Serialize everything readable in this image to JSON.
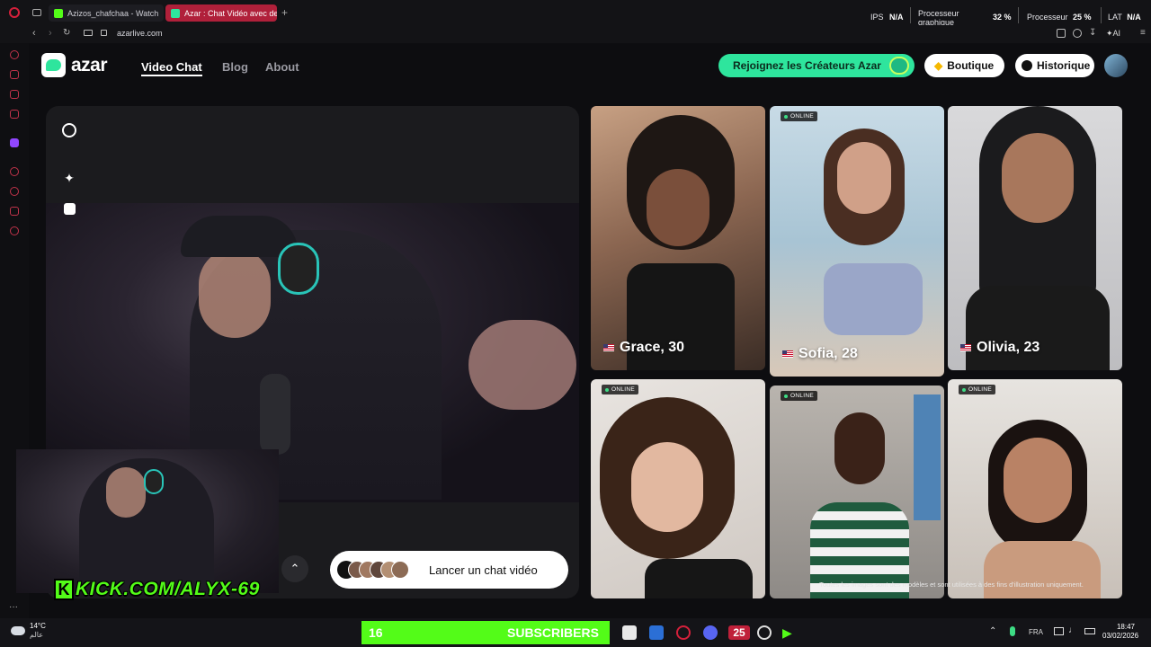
{
  "browser": {
    "tabs": [
      {
        "label": "Azizos_chafchaa - Watch",
        "active": false
      },
      {
        "label": "Azar : Chat Vidéo avec de",
        "active": true
      }
    ],
    "new_tab_symbol": "+",
    "url": "azarlive.com",
    "hud": {
      "ips_label": "IPS",
      "ips_value": "N/A",
      "gpu_label": "Processeur graphique",
      "gpu_value": "32 %",
      "cpu_label": "Processeur",
      "cpu_value": "25 %",
      "lat_label": "LAT",
      "lat_value": "N/A"
    },
    "ai_label": "AI"
  },
  "header": {
    "logo_text": "azar",
    "nav": [
      {
        "label": "Video Chat",
        "active": true
      },
      {
        "label": "Blog",
        "active": false
      },
      {
        "label": "About",
        "active": false
      }
    ],
    "creators_button": "Rejoignez les Créateurs Azar",
    "shop_button": "Boutique",
    "history_button": "Historique"
  },
  "video": {
    "start_button": "Lancer un chat vidéo",
    "watermark": "KICK.COM/ALYX-69"
  },
  "profiles": [
    {
      "name": "Grace, 30",
      "online": false
    },
    {
      "name": "Sofia, 28",
      "online": true,
      "online_label": "ONLINE"
    },
    {
      "name": "Olivia, 23",
      "online": false
    },
    {
      "name": "",
      "online": true,
      "online_label": "ONLINE"
    },
    {
      "name": "",
      "online": true,
      "online_label": "ONLINE"
    },
    {
      "name": "",
      "online": true,
      "online_label": "ONLINE"
    }
  ],
  "disclaimer": "Toutes les images sont des modèles et sont utilisées à des fins d'illustration uniquement.",
  "taskbar": {
    "weather_temp": "14°C",
    "weather_place": "عالم",
    "subs_count": "16",
    "subs_label": "SUBSCRIBERS",
    "badge_count": "25",
    "lang": "FRA",
    "time": "18:47",
    "date": "03/02/2026"
  },
  "colors": {
    "accent_green": "#2ee59d",
    "tab_active": "#b0203a"
  }
}
